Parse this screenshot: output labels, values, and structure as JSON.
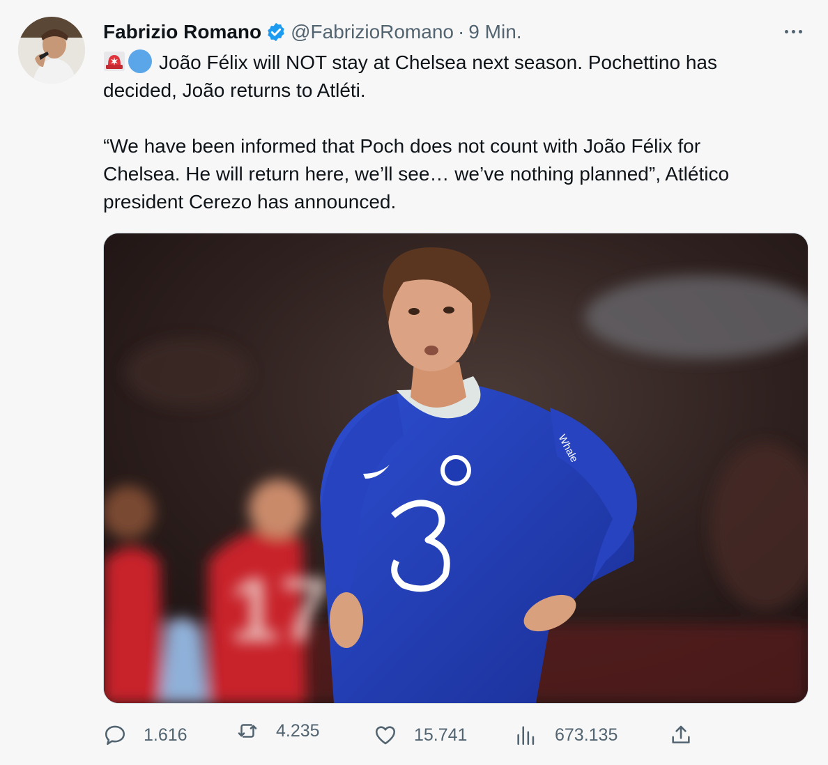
{
  "tweet": {
    "author_name": "Fabrizio Romano",
    "handle": "@FabrizioRomano",
    "separator": "·",
    "time": "9 Min.",
    "text_lines": [
      "João Félix will NOT stay at Chelsea next season. Pochettino has",
      "decided, João returns to Atléti.",
      "“We have been informed that Poch does not count with João Félix for",
      "Chelsea. He will return here, we’ll see… we’ve nothing planned”, Atlético",
      "president Cerezo has announced."
    ],
    "emojis": [
      "siren-icon",
      "blue-circle-icon"
    ],
    "media_alt": "",
    "jersey_number": "17",
    "sponsor_text": "Whale"
  },
  "actions": {
    "replies": "1.616",
    "retweets": "4.235",
    "likes": "15.741",
    "views": "673.135"
  },
  "icons": [
    "verified-icon",
    "more-icon",
    "reply-icon",
    "retweet-icon",
    "like-icon",
    "views-icon",
    "share-icon"
  ],
  "colors": {
    "background": "#f7f7f8",
    "text": "#0f1419",
    "secondary_text": "#536471",
    "verified_blue": "#1d9bf0",
    "chelsea_blue": "#1f3bb3"
  }
}
